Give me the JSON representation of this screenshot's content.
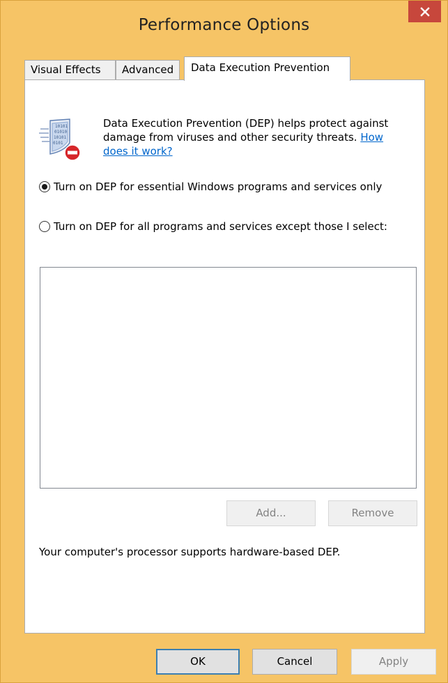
{
  "window": {
    "title": "Performance Options",
    "close_label": "×"
  },
  "tabs": [
    {
      "label": "Visual Effects",
      "active": false
    },
    {
      "label": "Advanced",
      "active": false
    },
    {
      "label": "Data Execution Prevention",
      "active": true
    }
  ],
  "dep": {
    "description": "Data Execution Prevention (DEP) helps protect against damage from viruses and other security threats.",
    "link_text": "How does it work?",
    "options": [
      {
        "label": "Turn on DEP for essential Windows programs and services only",
        "accel": "T",
        "selected": true
      },
      {
        "label": "Turn on DEP for all programs and services except those I select:",
        "accel": "u",
        "selected": false
      }
    ],
    "list_items": [],
    "add_label": "Add...",
    "add_accel": "d",
    "remove_label": "Remove",
    "remove_accel": "e",
    "status": "Your computer's processor supports hardware-based DEP."
  },
  "footer": {
    "ok_label": "OK",
    "cancel_label": "Cancel",
    "apply_label": "Apply",
    "apply_accel": "A"
  },
  "colors": {
    "frame": "#f6c466",
    "close": "#c7473c",
    "link": "#0066cc",
    "default_button_border": "#3c7fb1"
  },
  "icons": {
    "dep": "dep-shield-binary-icon",
    "close": "close-icon"
  }
}
